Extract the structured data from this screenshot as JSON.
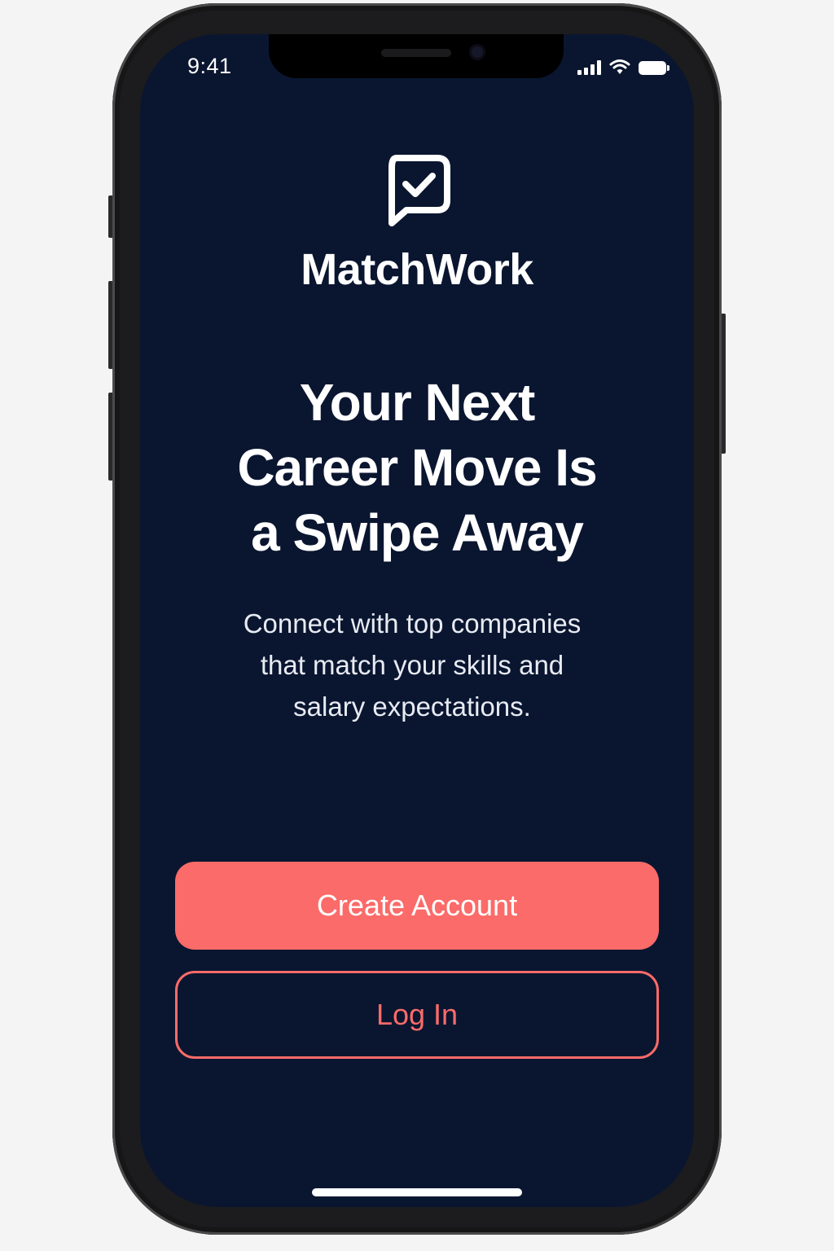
{
  "status_bar": {
    "time": "9:41",
    "icons": [
      "signal-icon",
      "wifi-icon",
      "battery-icon"
    ]
  },
  "brand": {
    "logo_icon": "chat-check-icon",
    "name": "MatchWork"
  },
  "headline": {
    "lines": [
      "Your Next",
      "Career Move Is",
      "a Swipe Away"
    ]
  },
  "subtitle": {
    "lines": [
      "Connect with top companies",
      "that match your skills and",
      "salary expectations."
    ]
  },
  "actions": {
    "create_account_label": "Create Account",
    "log_in_label": "Log In"
  },
  "colors": {
    "background": "#0a1630",
    "accent": "#fb6b69",
    "text": "#ffffff"
  }
}
